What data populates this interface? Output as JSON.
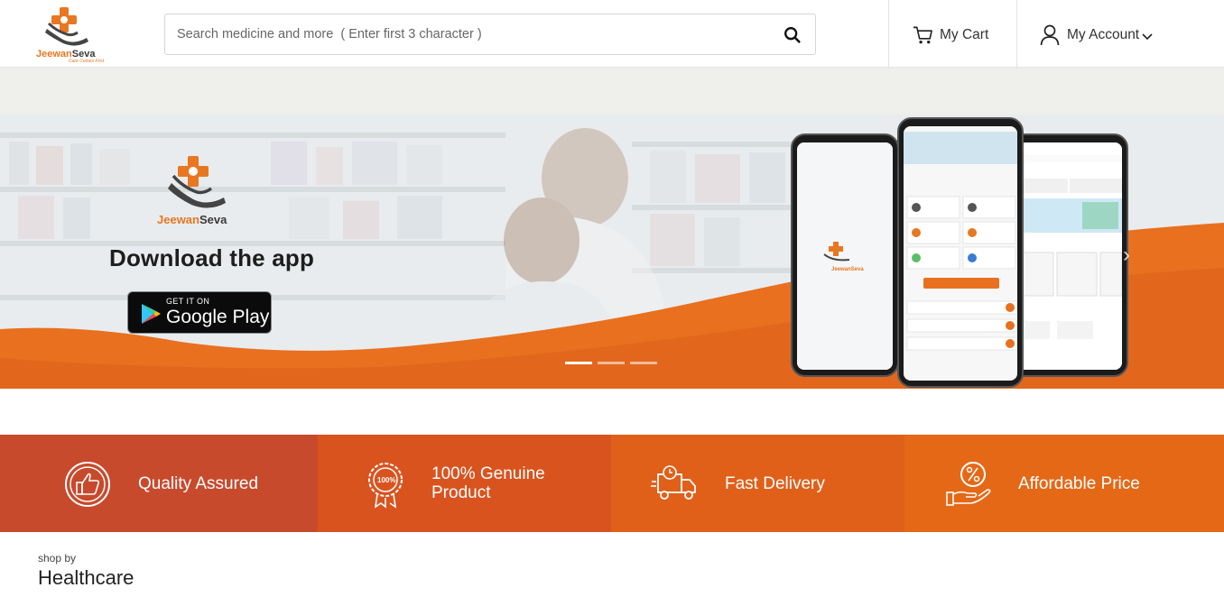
{
  "header": {
    "logo": {
      "name_part1": "Jeewan",
      "name_part2": "Seva",
      "tagline": "Care Comes First"
    },
    "search": {
      "placeholder": "Search medicine and more  ( Enter first 3 character )"
    },
    "cart_label": "My Cart",
    "account_label": "My Account"
  },
  "hero": {
    "logo": {
      "name_part1": "Jeewan",
      "name_part2": "Seva"
    },
    "title": "Download the app",
    "google_play": {
      "small": "GET IT ON",
      "big": "Google Play"
    },
    "slides": 3,
    "active_slide": 1
  },
  "features": [
    {
      "label_line1": "Quality Assured",
      "label_line2": "",
      "icon": "thumbs-up-icon",
      "color": "#c84a2c"
    },
    {
      "label_line1": "100% Genuine",
      "label_line2": "Product",
      "icon": "genuine-badge-icon",
      "color": "#d9531f"
    },
    {
      "label_line1": "Fast Delivery",
      "label_line2": "",
      "icon": "delivery-truck-icon",
      "color": "#e0601a"
    },
    {
      "label_line1": "Affordable Price",
      "label_line2": "",
      "icon": "discount-hand-icon",
      "color": "#e56817"
    }
  ],
  "section": {
    "kicker": "shop by",
    "title": "Healthcare"
  },
  "colors": {
    "accent": "#e87722",
    "hero_wave": "#e8701f"
  }
}
